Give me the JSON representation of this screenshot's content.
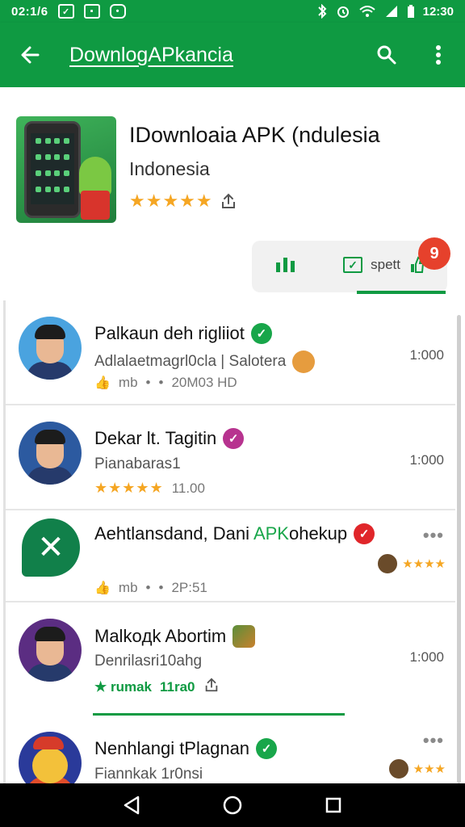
{
  "status_bar": {
    "time": "02:1/6",
    "right_text": "12:30"
  },
  "app_bar": {
    "query": "DownlogAPkancia"
  },
  "app": {
    "title": "IDownloaia APK (ndulesia",
    "subtitle": "Indonesia",
    "stars": "★★★★★"
  },
  "tabs": {
    "sort_label": "spett",
    "badge": "9"
  },
  "results": [
    {
      "name": "Palkaun deh rigliiot",
      "subtitle": "Adlalaetmagrl0cla | Salotera",
      "meta_prefix": "mb",
      "meta_text": "20M03 HD",
      "count": "1:000"
    },
    {
      "name": "Dekar lt. Tagitin",
      "subtitle": "Pianabaras1",
      "rating_stars": "★★★★★",
      "rating_value": "11.00",
      "count": "1:000"
    },
    {
      "name_before": "Aehtlansdand, Dani ",
      "name_highlight": "APK",
      "name_after": "ohekup",
      "meta_prefix": "mb",
      "meta_text": "2P:51",
      "more": "•••",
      "mini_stars": "★★★★"
    },
    {
      "name": "Malkoдk Abortim",
      "subtitle": "Denrilasri10ahg",
      "tag": "★ rumak",
      "tag_value": "11ra0",
      "count": "1:000"
    },
    {
      "name": "Nenhlangi tPlagnan",
      "subtitle": "Fiannkak 1r0nsi",
      "more": "•••",
      "mini_stars": "★★★"
    }
  ],
  "colors": {
    "primary_green": "#0f9a42",
    "star_gold": "#f5a623",
    "badge_red": "#e6412c"
  }
}
